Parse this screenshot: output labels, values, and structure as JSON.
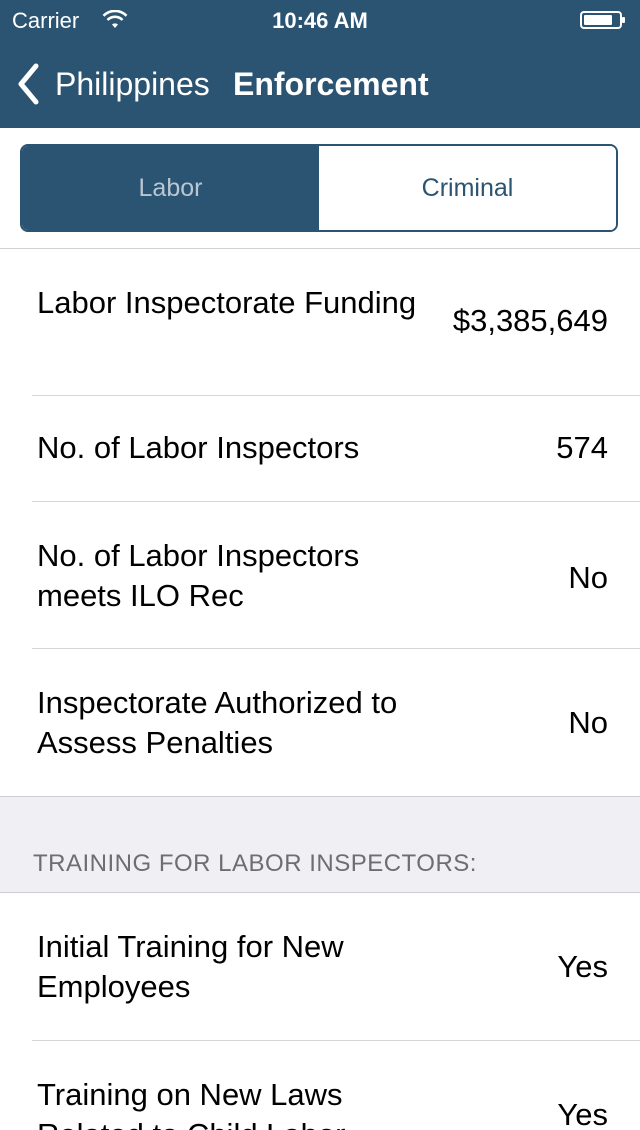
{
  "status": {
    "carrier": "Carrier",
    "time": "10:46 AM"
  },
  "nav": {
    "back_label": "Philippines",
    "title": "Enforcement"
  },
  "segments": [
    "Labor",
    "Criminal"
  ],
  "rows": [
    {
      "label": "Labor Inspectorate Funding",
      "value": "$3,385,649"
    },
    {
      "label": "No. of Labor Inspectors",
      "value": "574"
    },
    {
      "label": "No. of Labor Inspectors meets ILO Rec",
      "value": "No"
    },
    {
      "label": "Inspectorate Authorized to Assess Penalties",
      "value": "No"
    }
  ],
  "section": {
    "title": "TRAINING FOR LABOR INSPECTORS:"
  },
  "training_rows": [
    {
      "label": "Initial Training for New Employees",
      "value": "Yes"
    },
    {
      "label": "Training on New Laws Related to Child Labor",
      "value": "Yes"
    }
  ],
  "colors": {
    "brand": "#2a5472",
    "group_bg": "#efeff4"
  },
  "icons": [
    "wifi-icon",
    "battery-icon",
    "back-chevron-icon"
  ]
}
